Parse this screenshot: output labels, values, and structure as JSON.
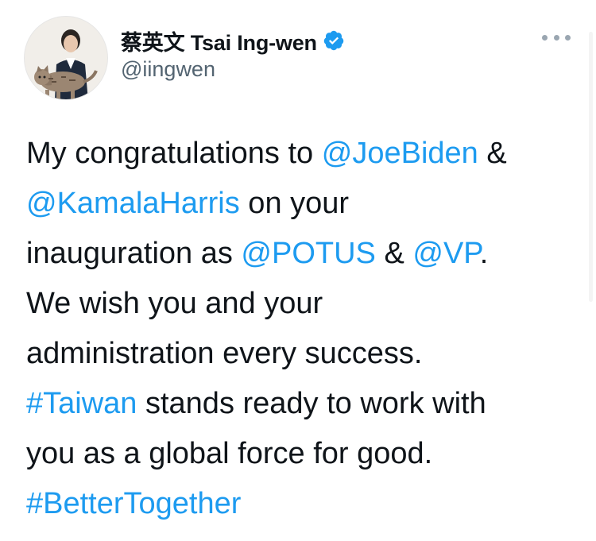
{
  "author": {
    "display_name": "蔡英文 Tsai Ing-wen",
    "handle": "@iingwen",
    "verified": true,
    "avatar_icon": "profile-photo-with-cat"
  },
  "menu": {
    "icon": "more-options-icon"
  },
  "tweet": {
    "lines": [
      [
        {
          "t": "My congratulations to ",
          "k": "text"
        },
        {
          "t": "@JoeBiden",
          "k": "mention"
        },
        {
          "t": " &",
          "k": "text"
        }
      ],
      [
        {
          "t": "@KamalaHarris",
          "k": "mention"
        },
        {
          "t": " on your",
          "k": "text"
        }
      ],
      [
        {
          "t": "inauguration as ",
          "k": "text"
        },
        {
          "t": "@POTUS",
          "k": "mention"
        },
        {
          "t": " & ",
          "k": "text"
        },
        {
          "t": "@VP",
          "k": "mention"
        },
        {
          "t": ".",
          "k": "text"
        }
      ],
      [
        {
          "t": "We wish you and your",
          "k": "text"
        }
      ],
      [
        {
          "t": "administration every success.",
          "k": "text"
        }
      ],
      [
        {
          "t": "#Taiwan",
          "k": "hashtag"
        },
        {
          "t": " stands ready to work with",
          "k": "text"
        }
      ],
      [
        {
          "t": "you as a global force for good.",
          "k": "text"
        }
      ],
      [
        {
          "t": "#BetterTogether",
          "k": "hashtag"
        }
      ]
    ]
  },
  "colors": {
    "link": "#1d9bf0",
    "text": "#0f1419",
    "secondary": "#536471",
    "verified_badge": "#1d9bf0"
  }
}
